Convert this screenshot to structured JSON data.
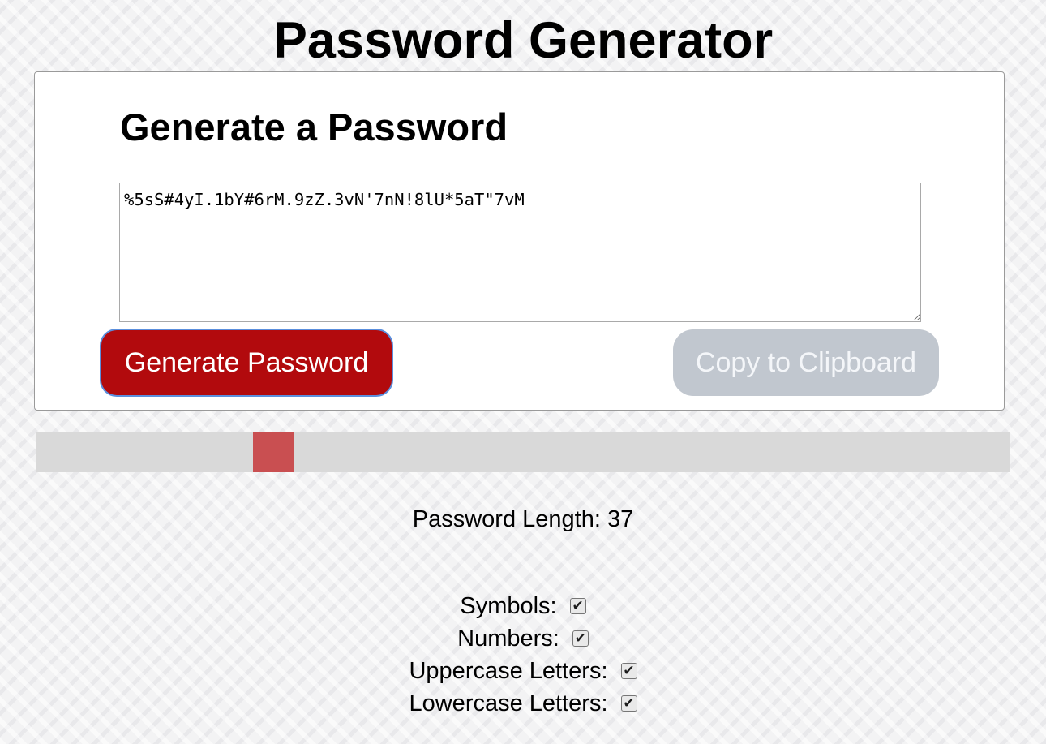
{
  "header": {
    "title": "Password Generator"
  },
  "card": {
    "title": "Generate a Password",
    "password_value": "%5sS#4yI.1bY#6rM.9zZ.3vN'7nN!8lU*5aT\"7vM",
    "generate_label": "Generate Password",
    "copy_label": "Copy to Clipboard"
  },
  "colors": {
    "generate_button": "#b20a0d",
    "copy_button_disabled": "#c1c7cf",
    "slider_track": "#d9d9d9",
    "slider_thumb": "#c94f51"
  },
  "length": {
    "label": "Password Length:",
    "value": "37",
    "slider_fraction": 0.232
  },
  "options": [
    {
      "label": "Symbols:",
      "checked": true
    },
    {
      "label": "Numbers:",
      "checked": true
    },
    {
      "label": "Uppercase Letters:",
      "checked": true
    },
    {
      "label": "Lowercase Letters:",
      "checked": true
    }
  ],
  "icons": {
    "checkmark": "check-icon",
    "resize_handle": "resize-grip-icon"
  }
}
